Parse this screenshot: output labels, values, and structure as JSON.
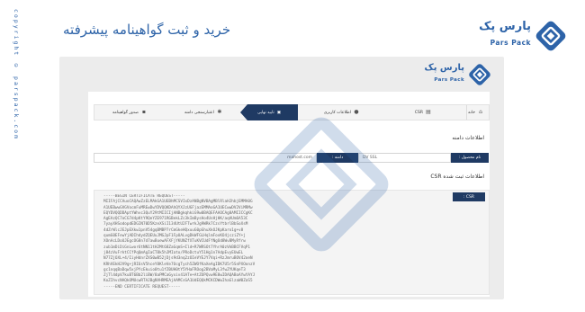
{
  "sidebar": {
    "copyright": "copyright © parspack.com"
  },
  "header": {
    "title": "خرید و ثبت گواهینامه پیشرفته",
    "brand_fa": "پارس پک",
    "brand_en": "Pars Pack"
  },
  "card": {
    "brand_fa": "پارس پک",
    "brand_en": "Pars Pack"
  },
  "steps": [
    {
      "label": "خانه",
      "icon": "home-icon"
    },
    {
      "label": "CSR",
      "icon": "document-icon"
    },
    {
      "label": "اطلاعات کاربری",
      "icon": "user-icon"
    },
    {
      "label": "تایید نهایی",
      "icon": "clipboard-icon"
    },
    {
      "label": "اعتبارسنجی دامنه",
      "icon": "gear-icon"
    },
    {
      "label": "صدور گواهینامه",
      "icon": "lock-icon"
    }
  ],
  "domain_section": {
    "title": "اطلاعات دامنه",
    "product_label": "نام محصول :",
    "product_value": "DV SSL",
    "domain_label": "دامنه :",
    "domain_value": "mahost.com"
  },
  "csr_section": {
    "title": "اطلاعات ثبت شده CSR",
    "tag_label": "CSR :",
    "text": "-----BEGIN CERTIFICATE REQUEST-----\nMIIFAjCCAuoCAQAwZzELMAkGA1UEBhMCSVIxDzANBgNVBAgMBlRlaHJhbjEMMA0G\nA1UEBwwGVGVocmFuMREwDwYDVQQKDAhQYXJzUGFjazEMMAoGA1UECwwDV2ViMRMw\nEQYDVQQDDAptYWhvc3QuY29tMIICIjANBgkqhkiG9w0BAQEFAAOCAg8AMIICCgKC\nAgEAzQC7oCG7d4pKtY9QeYZE971RGBekLZc3kImBysHo4UsHjHK/aqAUm6A53C\n7yayXHSodopdEDGIN70D5KzeXSiI134UtU2FTwrkJg9WRk7CzsYtbrlBbSoXsM\n4dZrWlcJEJpEXkw1pnV54gqBMBP7rCmGkeHQxuuG0pGhuXkOJKpKaro1g+v8\nqumG0EFewYjADIhdydZQEUuJMGJpF1FpUALvgDkWFGLHqlmFoxKO4jcziZY+j\nXOnAcLDoUJEgcOG8n7d7awBuewAFXFjYKUNZfXTuKVCUdFfNgOd8WvBMyRfrw\nzub1mDiDiGnLwor6tNN11tH2Mt68ZaGqmS+Ild+R7WRSOt7YhrA0zVkBBCFVqP1\nj84zVuFrktCCfPqQmAgIaCT8k5hJMIato/PRoDctuY51Hg1n7AdpEvyEUwEL\nN77ZjOXL+4/IiyHdnrZXS0wB52jDjs9d3nq2zOIeVYEJY7Vqi+RzJmruBOV42oeN\nKRhVEkH2V9g+jRI6sV5hceY8KleVe7OcgTych5ZWOfKaXeAgIDK7U5r5SnPXOonzV\ngc1nqqBaDqw5xjPYcEkuio0tu1fZ0UH0tY5YHaFROog2BVaMyL3fwZYUKqeT3\nZjTl4dpV7kuBT6Bb2liBW/8aPMCaGyxiv41ATe+AtZOPQvw9E8wIDAQABoAYwYAYJ\nKoZIhvcNAQkOMUcwRTAJBgNVHRMEAjAAMCsGA1UdEQQkMCKCDWwIhaGlzaW0ZaS5\n-----END CERTIFICATE REQUEST-----"
  },
  "colors": {
    "brand": "#2d63a8",
    "navy": "#1f3a63",
    "frame": "#ececec"
  }
}
